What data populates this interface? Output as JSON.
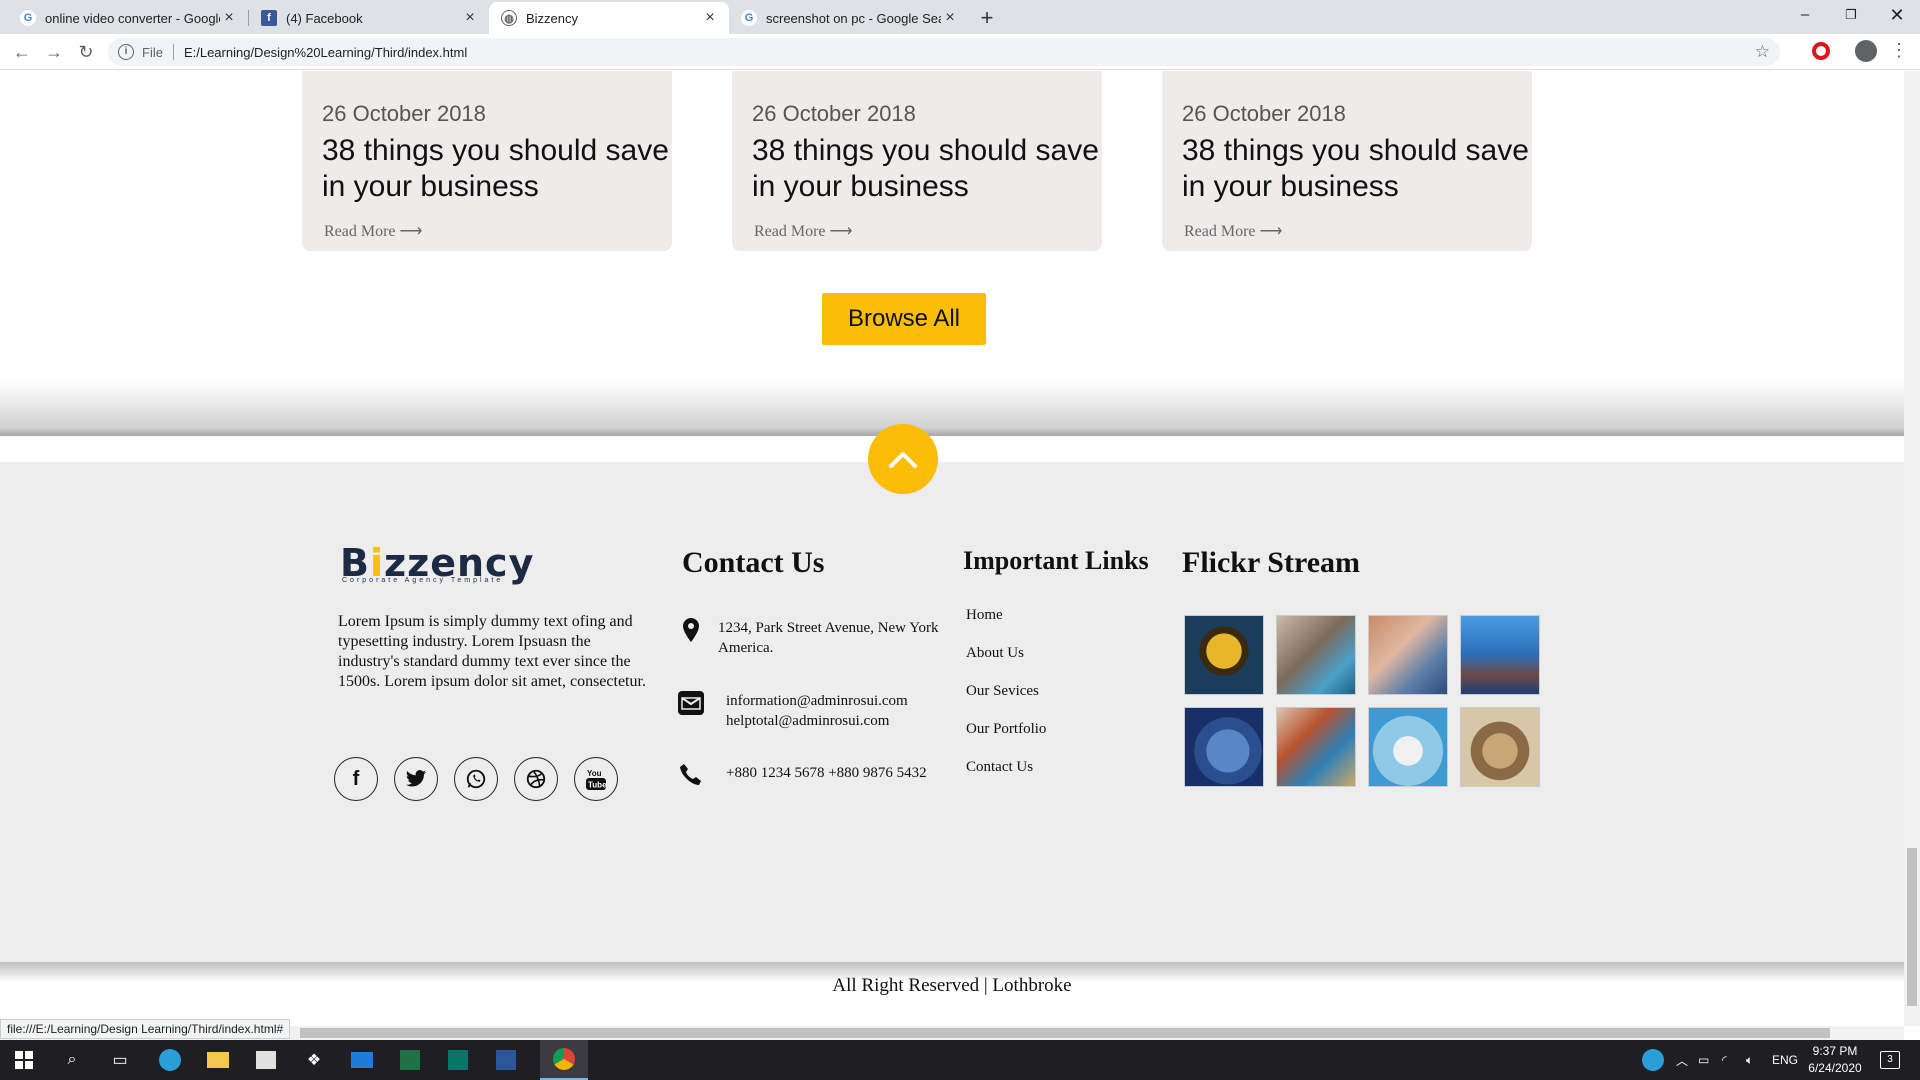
{
  "browser": {
    "tabs": [
      {
        "title": "online video converter - Google Se",
        "icon": "google-icon"
      },
      {
        "title": "(4) Facebook",
        "icon": "facebook-icon"
      },
      {
        "title": "Bizzency",
        "icon": "globe-icon"
      },
      {
        "title": "screenshot on pc - Google Search",
        "icon": "google-icon"
      }
    ],
    "active_tab": 2,
    "address": {
      "scheme_label": "File",
      "url": "E:/Learning/Design%20Learning/Third/index.html"
    },
    "status_url": "file:///E:/Learning/Design Learning/Third/index.html#"
  },
  "blog": {
    "cards": [
      {
        "date": "26 October 2018",
        "title": "38 things you should save in your business",
        "more": "Read More ⟶"
      },
      {
        "date": "26 October 2018",
        "title": "38 things you should save in your business",
        "more": "Read More ⟶"
      },
      {
        "date": "26 October 2018",
        "title": "38 things you should save in your business",
        "more": "Read More ⟶"
      }
    ],
    "browse_label": "Browse All"
  },
  "footer": {
    "logo": {
      "name_pre": "B",
      "name_dot": "i",
      "name_post": "zzency",
      "tagline": "Corporate Agency Template"
    },
    "about": "Lorem Ipsum is simply dummy text ofing and typesetting industry. Lorem Ipsuasn the industry's standard dummy text ever since the 1500s. Lorem ipsum dolor sit amet, consectetur.",
    "socials": [
      "facebook-icon",
      "twitter-icon",
      "whatsapp-icon",
      "dribbble-icon",
      "youtube-icon"
    ],
    "contact": {
      "heading": "Contact Us",
      "address": "1234, Park Street Avenue, New York America.",
      "email1": "information@adminrosui.com",
      "email2": "helptotal@adminrosui.com",
      "phone": "+880 1234 5678 +880 9876 5432"
    },
    "links": {
      "heading": "Important Links",
      "items": [
        "Home",
        "About Us",
        "Our Sevices",
        "Our Portfolio",
        "Contact Us"
      ]
    },
    "flickr": {
      "heading": "Flickr Stream"
    },
    "copyright": "All Right Reserved | Lothbroke"
  },
  "colors": {
    "accent": "#fbbd08",
    "footer_bg": "#ededed",
    "card_bg": "#f0ebeb"
  },
  "taskbar": {
    "language": "ENG",
    "time": "9:37 PM",
    "date": "6/24/2020",
    "notification_count": "3"
  }
}
